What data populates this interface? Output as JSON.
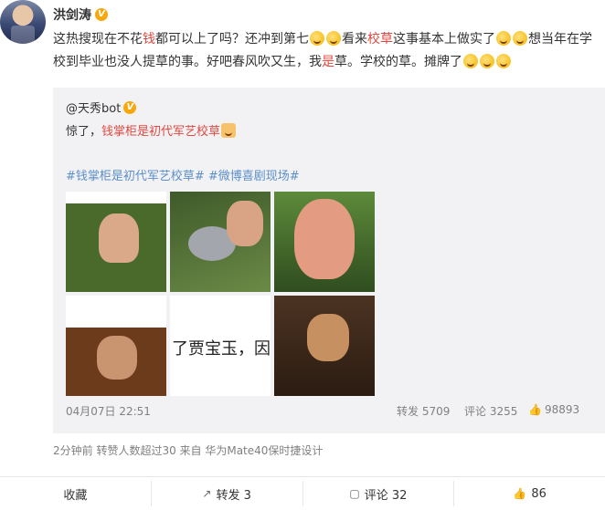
{
  "author": {
    "name": "洪剑涛"
  },
  "post": {
    "seg1": "这热搜现在不花",
    "seg2": "钱",
    "seg3": "都可以上了吗？还冲到第七",
    "seg4": "看来",
    "seg5": "校草",
    "seg6": "这事基本上做实了",
    "seg7": "想当年在学校到毕业也没人提草的事。好吧春风吹又生，我",
    "seg8": "是",
    "seg9": "草。学校的草。摊牌了"
  },
  "repost": {
    "author": "@天秀bot",
    "text_prefix": "惊了，",
    "text_highlight": "钱掌柜是初代军艺校草",
    "tags": "#钱掌柜是初代军艺校草# #微博喜剧现场#",
    "image_caption": "了贾宝玉，因为",
    "time": "04月07日 22:51",
    "share": "转发 5709",
    "comment": "评论 3255",
    "like": "98893"
  },
  "meta": "2分钟前  转赞人数超过30  来自 华为Mate40保时捷设计",
  "actions": {
    "collect": "收藏",
    "share": "转发 3",
    "comment": "评论 32",
    "like": "86"
  },
  "colors": {
    "highlight": "#e0483f",
    "link": "#5b8fc8",
    "repost_bg": "#f2f2f5"
  }
}
